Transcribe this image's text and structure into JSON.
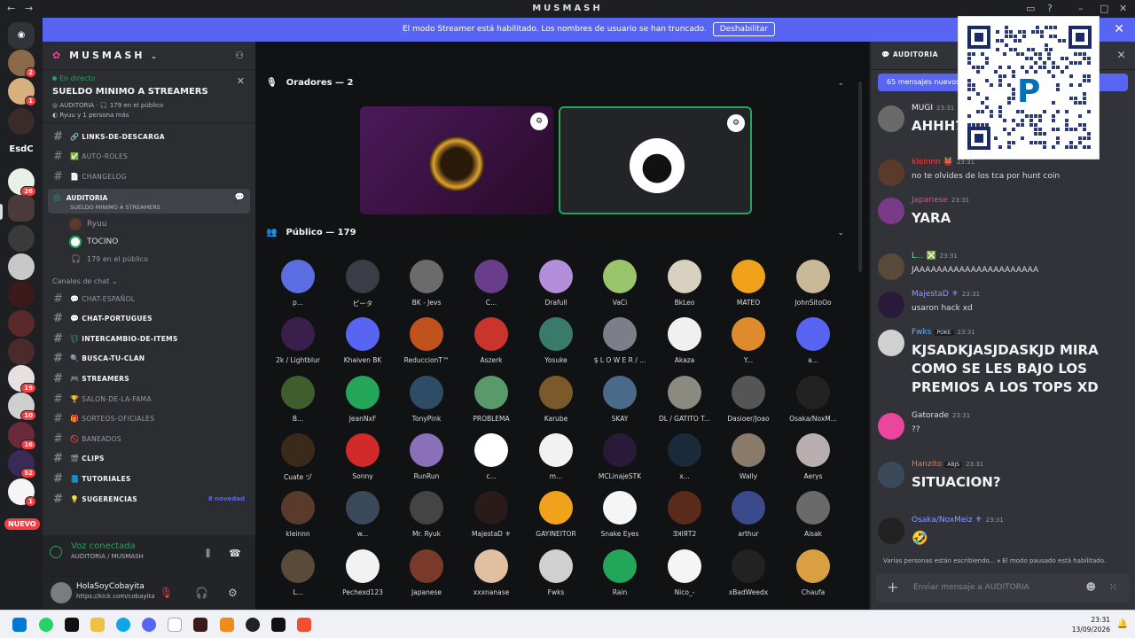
{
  "window": {
    "back": "←",
    "forward": "→",
    "title": "MUSMASH"
  },
  "server": {
    "name": "MUSMASH"
  },
  "live_panel": {
    "status": "En directo",
    "title": "SUELDO MINIMO A STREAMERS",
    "stage_channel": "AUDITORIA",
    "listeners": "179 en el público",
    "participants": "Ryuu y 1 persona más"
  },
  "streamer_banner": {
    "text": "El modo Streamer está habilitado. Los nombres de usuario se han truncado.",
    "button": "Deshabilitar"
  },
  "guild_badges": [
    "2",
    "1",
    "26",
    "19",
    "10",
    "16",
    "52",
    "1"
  ],
  "guild_text": "EsdC",
  "nuevo": "NUEVO",
  "channels_top": [
    {
      "emoji": "🔗",
      "name": "LINKS-DE-DESCARGA",
      "bold": true
    },
    {
      "emoji": "✅",
      "name": "AUTO-ROLES",
      "bold": false
    },
    {
      "emoji": "📄",
      "name": "CHANGELOG",
      "bold": false
    }
  ],
  "stage_channel": {
    "name": "AUDITORIA",
    "topic": "SUELDO MINIMO A STREAMERS",
    "users": [
      "Ryuu",
      "TOCINO"
    ],
    "listeners": "179 en el público"
  },
  "category": "Canales de chat",
  "channels": [
    {
      "emoji": "💬",
      "name": "CHAT-ESPAÑOL",
      "bold": false
    },
    {
      "emoji": "💬",
      "name": "CHAT-PORTUGUES",
      "bold": true
    },
    {
      "emoji": "💱",
      "name": "INTERCAMBIO-DE-ITEMS",
      "bold": true
    },
    {
      "emoji": "🔍",
      "name": "BUSCA-TU-CLAN",
      "bold": true
    },
    {
      "emoji": "🎮",
      "name": "STREAMERS",
      "bold": true
    },
    {
      "emoji": "🏆",
      "name": "SALON-DE-LA-FAMA",
      "bold": false
    },
    {
      "emoji": "🎁",
      "name": "SORTEOS-OFICIALES",
      "bold": false
    },
    {
      "emoji": "🚫",
      "name": "BANEADOS",
      "bold": false
    },
    {
      "emoji": "🎬",
      "name": "CLIPS",
      "bold": true
    },
    {
      "emoji": "📘",
      "name": "TUTORIALES",
      "bold": true
    },
    {
      "emoji": "💡",
      "name": "SUGERENCIAS",
      "bold": true,
      "note": "8 novedad"
    }
  ],
  "voice_connected": {
    "title": "Voz conectada",
    "sub": "AUDITORIA / MUSMASH"
  },
  "user": {
    "name": "HolaSoyCobayita",
    "status": "https://kick.com/cobayita"
  },
  "stage": {
    "speakers_header": "Oradores — 2",
    "audience_header": "Público — 179",
    "audience": [
      "p...",
      "ピータ",
      "BK - Jevs",
      "C...",
      "Drafull",
      "VaCi",
      "BkLeo",
      "MATEO",
      "JohnSitoOo",
      "2k / Lightblur",
      "Khaiven BK",
      "ReduccionT™",
      "Aszerk",
      "Yosuke",
      "$ L O W E R / ...",
      "Akaza",
      "Y...",
      "a...",
      "B...",
      "JeanNxF",
      "TonyPink",
      "PROBLEMA",
      "Karube",
      "SKAY",
      "DL / GATITO T...",
      "Dasioer/Joao",
      "Osaka/NoxM...",
      "Cuate ヅ",
      "Sonny",
      "RunRun",
      "c...",
      "m...",
      "MCLinajeSTK",
      "x...",
      "Wally",
      "Aerys",
      "kleinnn",
      "w...",
      "Mr. Ryuk",
      "MajestaD ⚜",
      "GAYINEITOR",
      "Snake Eyes",
      "ƎꓘIЯT2",
      "arthur",
      "Aisak",
      "L...",
      "Pechexd123",
      "Japanese",
      "xxxnanase",
      "Fwks",
      "Rain",
      "Nico_-",
      "xBadWeedx",
      "Chaufa"
    ],
    "colors": [
      "#5b6ee1",
      "#3a3d45",
      "#6b6b6b",
      "#6a3d8a",
      "#b28fd8",
      "#9ac46a",
      "#d8d0c0",
      "#f0a21b",
      "#c9b999",
      "#3a1f4d",
      "#5865f2",
      "#c2521d",
      "#c9342c",
      "#3a7a6a",
      "#7b7f8a",
      "#f0f0f0",
      "#e08a2e",
      "#5865f2",
      "#3f5e2e",
      "#23a55a",
      "#2f4c66",
      "#5a9a6a",
      "#7a5a2a",
      "#4a6a8a",
      "#8a8a80",
      "#555",
      "#222",
      "#3a2a1a",
      "#d22a2a",
      "#8a70b8",
      "#ffffff",
      "#f2f2f2",
      "#2a1a3a",
      "#1a2a3a",
      "#8a7a6a",
      "#b8aeb0",
      "#5a3a2a",
      "#3a4a5a",
      "#444",
      "#2a1a1a",
      "#f0a21b",
      "#f5f5f5",
      "#5a2a1a",
      "#3a4a8a",
      "#6a6a6a",
      "#5a4a3a",
      "#f2f2f2",
      "#7a3a2a",
      "#e0c0a0",
      "#d0d0d0",
      "#23a55a",
      "#f5f5f5",
      "#222",
      "#d8a040"
    ]
  },
  "chat": {
    "header": "AUDITORIA",
    "new_messages": "65 mensajes nuevos",
    "messages": [
      {
        "author": "MUGI",
        "time": "23:31",
        "text": "AHHH?",
        "big": true,
        "color": "#f2f3f5",
        "avatar": "#6a6a6a"
      },
      {
        "author": "kleinnn 👹",
        "time": "23:31",
        "text": "no te olvides de los tca por hunt coin",
        "big": false,
        "color": "#f23f43",
        "avatar": "#5a3a2a"
      },
      {
        "author": "Japanese",
        "time": "23:31",
        "text": "YARA",
        "big": true,
        "color": "#eb459e",
        "avatar": "#7a3a8a"
      },
      {
        "author": "L... ❎",
        "time": "23:31",
        "text": "JAAAAAAAAAAAAAAAAAAAAAA",
        "big": false,
        "color": "#57f287",
        "avatar": "#5a4a3a"
      },
      {
        "author": "MajestaD ⚜",
        "time": "23:31",
        "text": "usaron hack xd",
        "big": false,
        "color": "#8b9cff",
        "avatar": "#2a1a3a"
      },
      {
        "author": "Fwks",
        "tag": "POKE",
        "time": "23:31",
        "text": "KJSADKJASJDASKJD MIRA COMO SE LES BAJO LOS PREMIOS A LOS TOPS XD",
        "big": true,
        "color": "#5ab0ff",
        "avatar": "#d0d0d0"
      },
      {
        "author": "Gatorade",
        "time": "23:31",
        "text": "??",
        "big": false,
        "color": "#dbdee1",
        "avatar": "#eb459e"
      },
      {
        "author": "Hanzito",
        "tag": "ABJS",
        "time": "23:31",
        "text": "SITUACION?",
        "big": true,
        "color": "#f27a3f",
        "avatar": "#3a4a5a"
      },
      {
        "author": "Osaka/NoxMeiz ⚜",
        "time": "23:31",
        "text": "🤣",
        "big": true,
        "color": "#8b9cff",
        "avatar": "#222"
      }
    ],
    "typing": "Varias personas están escribiendo... ⏸ El modo pausado está habilitado.",
    "input_placeholder": "Enviar mensaje a AUDITORIA"
  },
  "taskbar": {
    "time": "23:31",
    "date": "13/09/2026"
  }
}
